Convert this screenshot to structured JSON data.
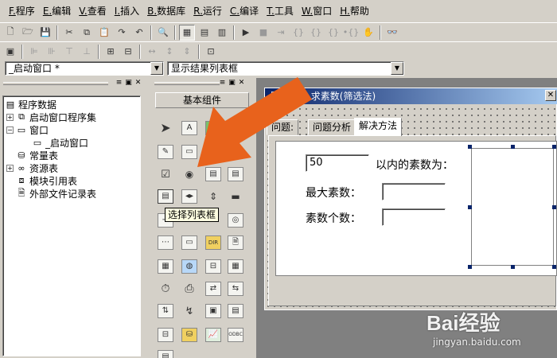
{
  "menu": [
    "F.程序",
    "E.编辑",
    "V.查看",
    "I.插入",
    "B.数据库",
    "R.运行",
    "C.编译",
    "T.工具",
    "W.窗口",
    "H.帮助"
  ],
  "combos": {
    "window": "_启动窗口 *",
    "event": "显示结果列表框"
  },
  "tree": {
    "root": "程序数据",
    "items": [
      "启动窗口程序集",
      "窗口",
      "_启动窗口",
      "常量表",
      "资源表",
      "模块引用表",
      "外部文件记录表"
    ]
  },
  "palette": {
    "header": "基本组件",
    "tooltip": "选择列表框",
    "label_icon_text": "A",
    "odbc_text": "ODBC",
    "dir_text": "DIR"
  },
  "form": {
    "title": "最     算法 - 求素数(筛选法)",
    "tabs": [
      "问题:",
      "问题分析",
      "解决方法"
    ],
    "input_value": "50",
    "label_range": "以内的素数为：",
    "label_max": "最大素数：",
    "label_count": "素数个数："
  },
  "watermark": {
    "logo": "Bai经验",
    "site": "jingyan.baidu.com"
  },
  "colors": {
    "arrow": "#e8621c",
    "titlebar": "#0a246a",
    "chrome": "#d4d0c8"
  }
}
